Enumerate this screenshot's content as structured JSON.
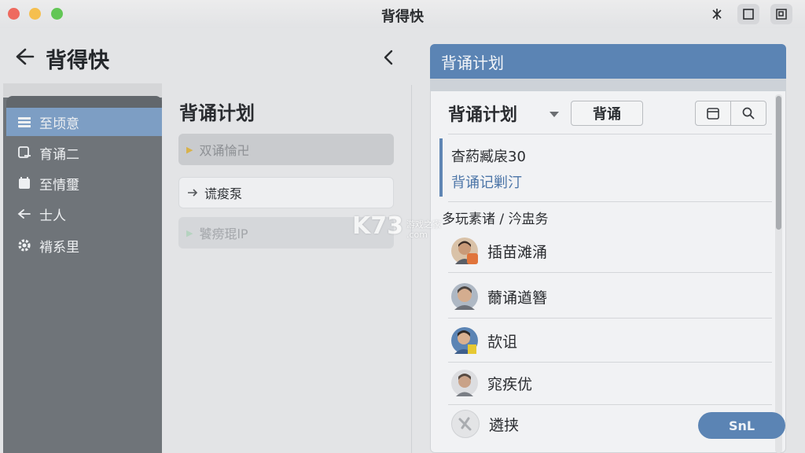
{
  "window": {
    "title": "背得快"
  },
  "header": {
    "app_title": "背得快"
  },
  "sidebar": {
    "items": [
      {
        "label": "至顷意",
        "icon": "list-icon",
        "active": true
      },
      {
        "label": "育诵二",
        "icon": "card-icon",
        "active": false
      },
      {
        "label": "至情璽",
        "icon": "notebook-icon",
        "active": false
      },
      {
        "label": "士人",
        "icon": "arrow-left-icon",
        "active": false
      },
      {
        "label": "褙系里",
        "icon": "gear-icon",
        "active": false
      }
    ]
  },
  "middle": {
    "title": "背诵计划",
    "items": [
      {
        "label": "双诵惀卍",
        "icon": "triangle-right-icon"
      },
      {
        "label": "谎痠泵",
        "icon": "arrow-right-icon"
      },
      {
        "label": "饕痨琨lP",
        "icon": "triangle-right-icon"
      }
    ]
  },
  "panel": {
    "header": "背诵计划",
    "title": "背诵计划",
    "recite_button": "背诵",
    "note_line1": "杳葯臧扆30",
    "note_line2": "背诵记剿汀",
    "section_label": "多玩素诸 / 汵盅务",
    "users": [
      {
        "name": "插苗滩涌",
        "badge_color": "#e0743b"
      },
      {
        "name": "薾诵遒簪",
        "badge_color": ""
      },
      {
        "name": "欯诅",
        "badge_color": "#e6c832"
      },
      {
        "name": "窕疾优",
        "badge_color": ""
      },
      {
        "name": "遴挟",
        "badge_color": ""
      }
    ],
    "fab_label": "SnL"
  },
  "watermark": {
    "brand": "K73",
    "site": "游戏之家",
    "domain": ".com"
  },
  "colors": {
    "accent": "#5b84b4",
    "sidebar": "#6f7479"
  }
}
